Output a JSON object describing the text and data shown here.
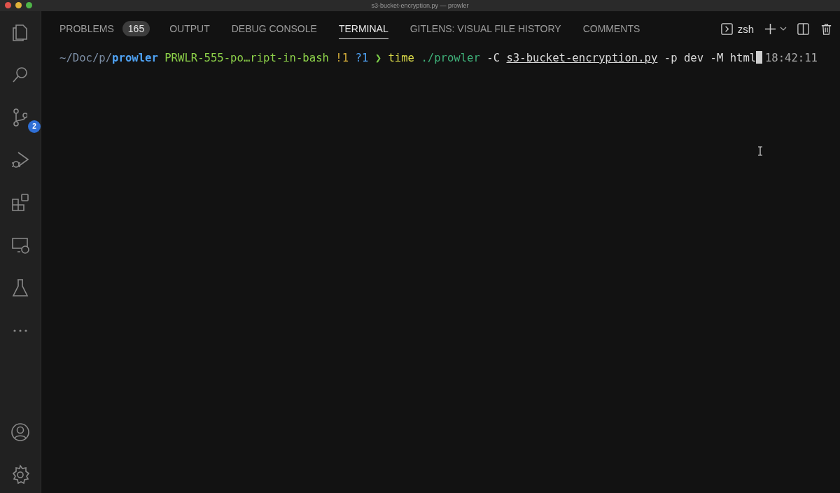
{
  "window": {
    "title": "s3-bucket-encryption.py — prowler"
  },
  "activity_bar": {
    "top": [
      {
        "kind": "explorer"
      },
      {
        "kind": "search"
      },
      {
        "kind": "source-control",
        "badge": "2"
      },
      {
        "kind": "run-debug"
      },
      {
        "kind": "extensions"
      },
      {
        "kind": "remote"
      },
      {
        "kind": "testing"
      },
      {
        "kind": "more"
      }
    ],
    "bottom": [
      {
        "kind": "accounts"
      },
      {
        "kind": "settings"
      }
    ]
  },
  "panel": {
    "tabs": [
      {
        "label": "PROBLEMS",
        "badge": "165",
        "selected": false
      },
      {
        "label": "OUTPUT",
        "selected": false
      },
      {
        "label": "DEBUG CONSOLE",
        "selected": false
      },
      {
        "label": "TERMINAL",
        "selected": true
      },
      {
        "label": "GITLENS: VISUAL FILE HISTORY",
        "selected": false
      },
      {
        "label": "COMMENTS",
        "selected": false
      }
    ],
    "terminal_name": "zsh"
  },
  "terminal": {
    "lines": [
      {
        "segments": [
          {
            "kind": "path",
            "text": "~/Doc/p/"
          },
          {
            "kind": "dir",
            "text": "prowler"
          },
          {
            "kind": "branch",
            "text": "PRWLR-555-po…ript-in-bash"
          },
          {
            "kind": "modified",
            "text": "!1"
          },
          {
            "kind": "untracked",
            "text": "?1"
          },
          {
            "kind": "prompt",
            "text": "❯"
          },
          {
            "kind": "builtin",
            "text": "time"
          },
          {
            "kind": "executable",
            "text": "./prowler"
          },
          {
            "kind": "arg",
            "text": "-C"
          },
          {
            "kind": "file",
            "text": "s3-bucket-encryption.py"
          },
          {
            "kind": "arg",
            "text": "-p dev -M html"
          }
        ],
        "time": "18:42:11"
      }
    ]
  }
}
